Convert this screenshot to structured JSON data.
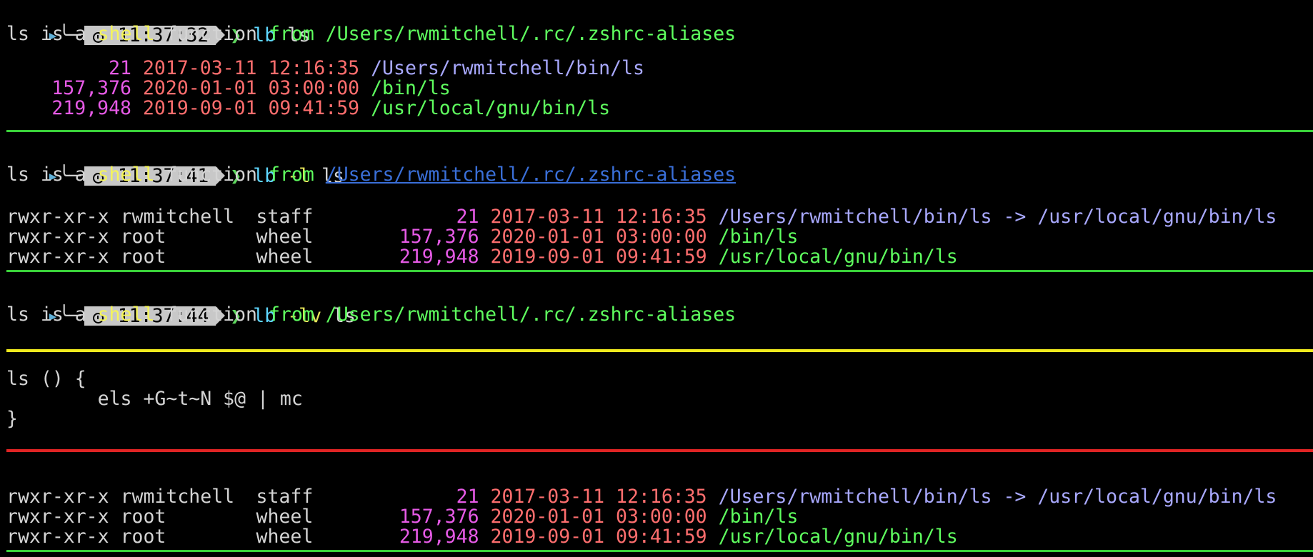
{
  "prompts": [
    {
      "time": "11:37:32",
      "cmd": "lb",
      "flags": "",
      "arg": "ls"
    },
    {
      "time": "11:37:41",
      "cmd": "lb",
      "flags": "-l",
      "arg": "ls"
    },
    {
      "time": "11:37:44",
      "cmd": "lb",
      "flags": "-lv",
      "arg": "ls"
    }
  ],
  "prompt_glyphs": {
    "left_arrow": "▸",
    "tree": "╰─",
    "chevron": "❯"
  },
  "typeline": {
    "prefix": "ls is a ",
    "shell": "shell",
    "function": " function ",
    "from": "from",
    "path": "/Users/rwmitchell/.rc/.zshrc-aliases"
  },
  "block1": [
    {
      "size": "21",
      "date": "2017-03-11 12:16:35",
      "path": "/Users/rwmitchell/bin/ls"
    },
    {
      "size": "157,376",
      "date": "2020-01-01 03:00:00",
      "path": "/bin/ls"
    },
    {
      "size": "219,948",
      "date": "2019-09-01 09:41:59",
      "path": "/usr/local/gnu/bin/ls"
    }
  ],
  "long_rows": [
    {
      "perm": "rwxr-xr-x",
      "user": "rwmitchell",
      "group": "staff",
      "size": "21",
      "date": "2017-03-11 12:16:35",
      "path": "/Users/rwmitchell/bin/ls",
      "arrow": " -> ",
      "target": "/usr/local/gnu/bin/ls"
    },
    {
      "perm": "rwxr-xr-x",
      "user": "root",
      "group": "wheel",
      "size": "157,376",
      "date": "2020-01-01 03:00:00",
      "path": "/bin/ls",
      "arrow": "",
      "target": ""
    },
    {
      "perm": "rwxr-xr-x",
      "user": "root",
      "group": "wheel",
      "size": "219,948",
      "date": "2019-09-01 09:41:59",
      "path": "/usr/local/gnu/bin/ls",
      "arrow": "",
      "target": ""
    }
  ],
  "func_def": {
    "line1": "ls () {",
    "line2": "        els +G~t~N $@ | mc",
    "line3": "}"
  },
  "colors": {
    "background": "#000000",
    "rule_green": "#3ad13a",
    "rule_yellow": "#f0ea1e",
    "rule_red": "#e02424",
    "size": "#e65ae6",
    "date": "#ff6e6e",
    "symlink": "#a9a9ff",
    "path": "#5fff5f"
  }
}
